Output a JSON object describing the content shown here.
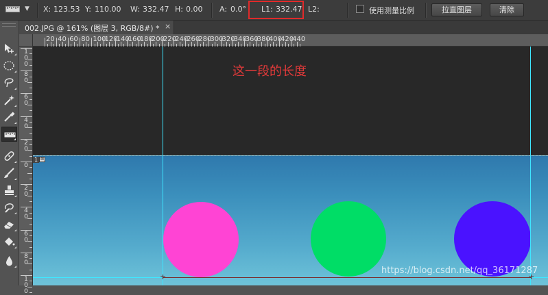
{
  "options_bar": {
    "tool_icon": "ruler-icon",
    "x_label": "X:",
    "x_value": "123.53",
    "y_label": "Y:",
    "y_value": "110.00",
    "w_label": "W:",
    "w_value": "332.47",
    "h_label": "H:",
    "h_value": "0.00",
    "a_label": "A:",
    "a_value": "0.0°",
    "l1_label": "L1:",
    "l1_value": "332.47",
    "l2_label": "L2:",
    "use_scale_label": "使用测量比例",
    "use_scale_checked": false,
    "straighten_label": "拉直图层",
    "clear_label": "清除"
  },
  "document_tab": {
    "title": "002.JPG @ 161% (图层 3, RGB/8#) *",
    "close_glyph": "×"
  },
  "toolbar": {
    "tools": [
      "move-tool",
      "marquee-tool",
      "lasso-tool",
      "magic-wand-tool",
      "eyedropper-tool",
      "ruler-tool",
      "healing-brush-tool",
      "brush-tool",
      "clone-stamp-tool",
      "history-brush-tool",
      "eraser-tool",
      "paint-bucket-tool",
      "blur-tool"
    ],
    "active_tool": "ruler-tool"
  },
  "rulers": {
    "top_labels": [
      "20",
      "40",
      "60",
      "80",
      "100",
      "120",
      "140",
      "160",
      "180",
      "200",
      "220",
      "240",
      "260",
      "280",
      "300",
      "320",
      "340",
      "360",
      "380",
      "400",
      "420",
      "440"
    ],
    "left_labels": [
      "1\n0\n0",
      "8\n0",
      "6\n0",
      "4\n0",
      "2\n0",
      "0",
      "2\n0",
      "4\n0",
      "6\n0",
      "8\n0",
      "1\n0\n0"
    ],
    "corner_label": ""
  },
  "canvas": {
    "annotation": "这一段的长度",
    "layer_badge": "1",
    "watermark": "https://blog.csdn.net/qq_36171287",
    "circles": [
      {
        "name": "pink-circle",
        "color": "#ff44d4"
      },
      {
        "name": "green-circle",
        "color": "#00dd66"
      },
      {
        "name": "blue-circle",
        "color": "#4a12ff"
      }
    ],
    "guide_color": "#3fe6ff",
    "measure_line_color": "#7a3030"
  }
}
